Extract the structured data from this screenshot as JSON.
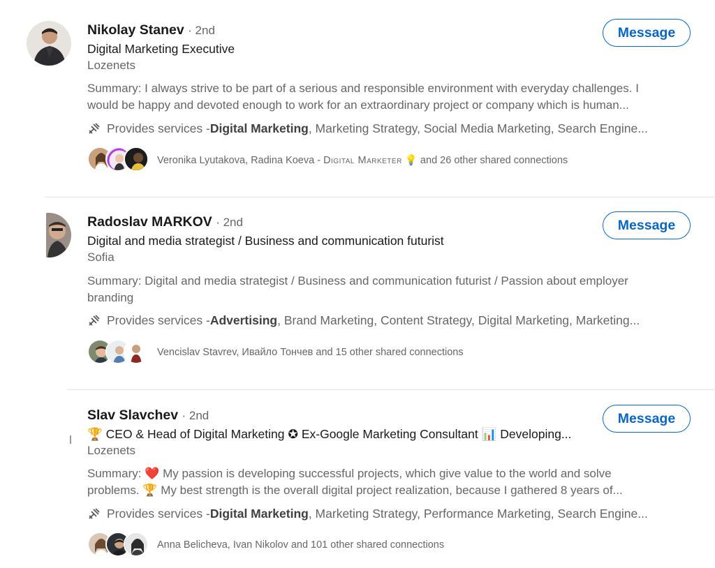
{
  "results": [
    {
      "name": "Nikolay Stanev",
      "degree": "· 2nd",
      "headline": "Digital Marketing Executive",
      "location": "Lozenets",
      "summary_line1": "Summary: I always strive to be part of a serious and responsible environment with everyday challenges. I",
      "summary_line2": "would be happy and devoted enough to work for an extraordinary project or company which is human...",
      "services_prefix": "Provides services - ",
      "services_bold": "Digital Marketing",
      "services_rest": ", Marketing Strategy, Social Media Marketing, Search Engine...",
      "shared_a": "Veronika Lyutakova, Radina Koeva - ",
      "shared_sc": "Digital Marketer",
      "shared_emoji": "💡",
      "shared_b": " and 26 other shared connections",
      "message_label": "Message"
    },
    {
      "name": "Radoslav MARKOV",
      "degree": "· 2nd",
      "headline": "Digital and media strategist / Business and communication futurist",
      "location": "Sofia",
      "summary_line1": "Summary: Digital and media strategist / Business and communication futurist / Passion about employer",
      "summary_line2": "branding",
      "services_prefix": "Provides services - ",
      "services_bold": "Advertising",
      "services_rest": ", Brand Marketing, Content Strategy, Digital Marketing, Marketing...",
      "shared_text": "Vencislav Stavrev, Ивайло Тончев and 15 other shared connections",
      "message_label": "Message"
    },
    {
      "name": "Slav Slavchev",
      "degree": "· 2nd",
      "headline": "🏆 CEO & Head of Digital Marketing ✪ Ex-Google Marketing Consultant 📊 Developing...",
      "location": "Lozenets",
      "summary_line1": "Summary: ❤️ My passion is developing successful projects, which give value to the world and solve",
      "summary_line2": "problems. 🏆 My best strength is the overall digital project realization, because I gathered 8 years of...",
      "services_prefix": "Provides services - ",
      "services_bold": "Digital Marketing",
      "services_rest": ", Marketing Strategy, Performance Marketing, Search Engine...",
      "shared_text": "Anna Belicheva, Ivan Nikolov and 101 other shared connections",
      "message_label": "Message"
    }
  ],
  "icons": {
    "services": "tools-icon",
    "avatar": "profile-photo"
  },
  "colors": {
    "accent": "#0a66c2",
    "text_primary": "#191919",
    "text_secondary": "#666666"
  }
}
